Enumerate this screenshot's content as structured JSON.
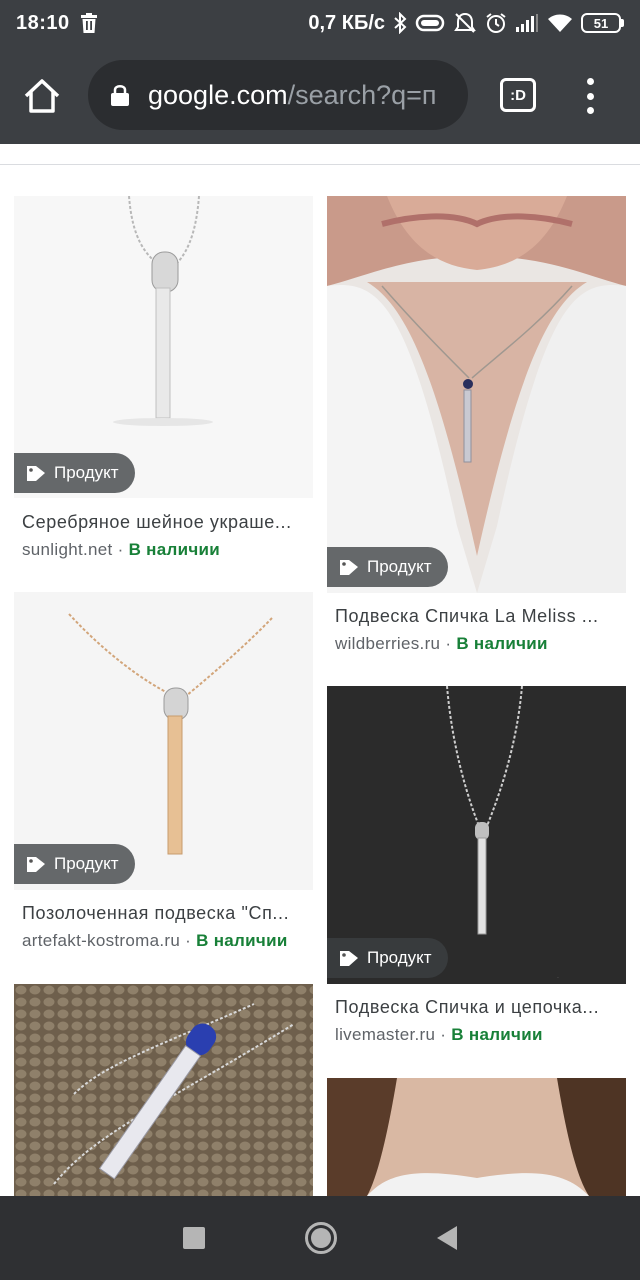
{
  "status_bar": {
    "time": "18:10",
    "speed": "0,7 КБ/с",
    "battery": "51",
    "icons": [
      "trash-icon",
      "bluetooth-icon",
      "vibrate-icon",
      "dnd-icon",
      "alarm-icon",
      "signal-icon",
      "wifi-icon",
      "battery-icon"
    ]
  },
  "browser": {
    "url_host": "google.com",
    "url_rest": "/search?q=п",
    "tabs_label": ":D"
  },
  "results": [
    {
      "badge": "Продукт",
      "title": "Серебряное шейное украше...",
      "source": "sunlight.net",
      "separator": " · ",
      "stock": "В наличии"
    },
    {
      "badge": "Продукт",
      "title": "Подвеска Спичка La Meliss ...",
      "source": "wildberries.ru",
      "separator": " · ",
      "stock": "В наличии"
    },
    {
      "badge": "Продукт",
      "title": "Позолоченная подвеска \"Сп...",
      "source": "artefakt-kostroma.ru",
      "separator": " · ",
      "stock": "В наличии"
    },
    {
      "badge": "Продукт",
      "title": "Подвеска Спичка и цепочка...",
      "source": "livemaster.ru",
      "separator": " · ",
      "stock": "В наличии"
    }
  ],
  "colors": {
    "chrome_bar": "#3c3f43",
    "stock_green": "#188038",
    "source_gray": "#5f6368"
  }
}
